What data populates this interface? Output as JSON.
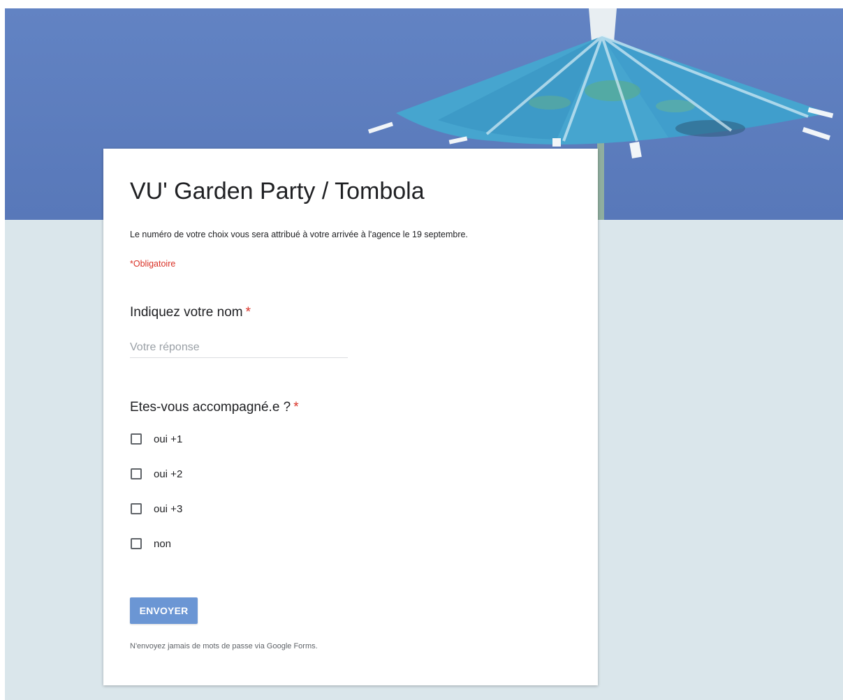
{
  "form": {
    "title": "VU' Garden Party / Tombola",
    "description": "Le numéro de votre choix vous sera attribué à votre arrivée à l'agence le 19 septembre.",
    "required_note": "*Obligatoire"
  },
  "questions": [
    {
      "title": "Indiquez votre nom",
      "required_marker": "*",
      "input_placeholder": "Votre réponse",
      "input_value": ""
    },
    {
      "title": "Etes-vous accompagné.e ?",
      "required_marker": "*",
      "options": [
        "oui +1",
        "oui +2",
        "oui +3",
        "non"
      ]
    }
  ],
  "submit_label": "ENVOYER",
  "footer_note": "N'envoyez jamais de mots de passe via Google Forms.",
  "colors": {
    "banner": "#6283c3",
    "page_background": "#dae6eb",
    "required": "#d93025",
    "submit_button": "#6b96d4"
  },
  "icons": {
    "banner_image": "cocktail-umbrella-image",
    "checkbox": "checkbox-unchecked"
  }
}
